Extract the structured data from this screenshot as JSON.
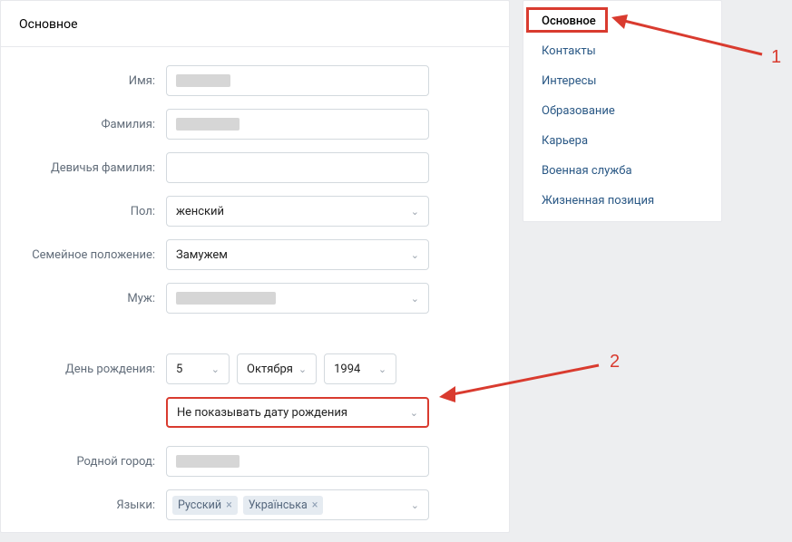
{
  "header": {
    "title": "Основное"
  },
  "form": {
    "first_name": {
      "label": "Имя:"
    },
    "last_name": {
      "label": "Фамилия:"
    },
    "maiden_name": {
      "label": "Девичья фамилия:"
    },
    "gender": {
      "label": "Пол:",
      "value": "женский"
    },
    "marital": {
      "label": "Семейное положение:",
      "value": "Замужем"
    },
    "spouse": {
      "label": "Муж:"
    },
    "birthday": {
      "label": "День рождения:",
      "day": "5",
      "month": "Октября",
      "year": "1994"
    },
    "bday_visibility": {
      "value": "Не показывать дату рождения"
    },
    "hometown": {
      "label": "Родной город:"
    },
    "languages": {
      "label": "Языки:",
      "tags": [
        "Русский",
        "Українська"
      ]
    }
  },
  "sidebar": {
    "items": [
      "Основное",
      "Контакты",
      "Интересы",
      "Образование",
      "Карьера",
      "Военная служба",
      "Жизненная позиция"
    ]
  },
  "annotations": {
    "num1": "1",
    "num2": "2"
  }
}
